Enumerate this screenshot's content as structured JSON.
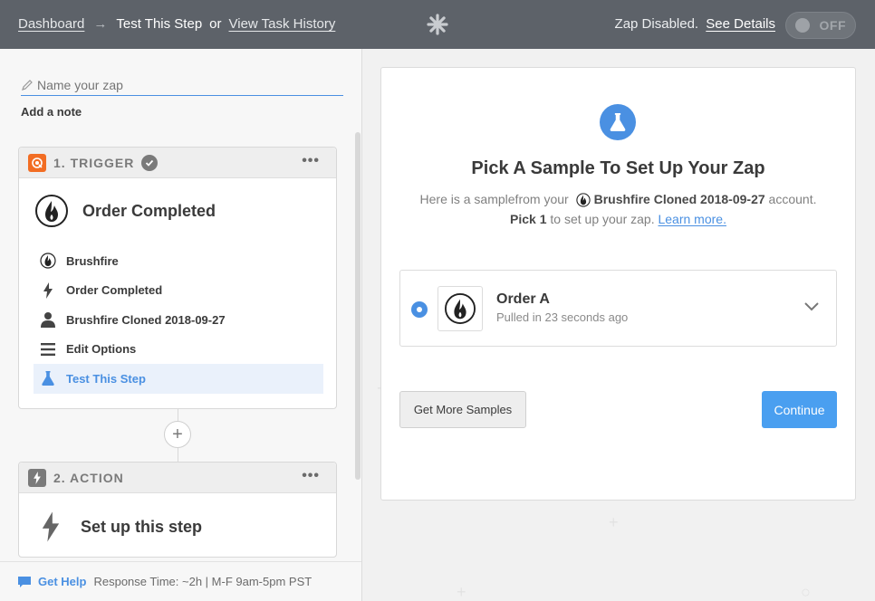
{
  "header": {
    "breadcrumb": {
      "dashboard": "Dashboard",
      "arrow": "→",
      "current": "Test This Step",
      "or": "or",
      "history": "View Task History"
    },
    "status_text": "Zap Disabled.",
    "see_details": "See Details",
    "toggle_label": "OFF"
  },
  "sidebar": {
    "zap_name_placeholder": "Name your zap",
    "add_note": "Add a note",
    "trigger": {
      "number_title": "1. TRIGGER",
      "menu": "•••",
      "app_event": "Order Completed",
      "steps": [
        {
          "label": "Brushfire",
          "icon": "brushfire-icon"
        },
        {
          "label": "Order Completed",
          "icon": "bolt-icon"
        },
        {
          "label": "Brushfire Cloned 2018-09-27",
          "icon": "user-icon"
        },
        {
          "label": "Edit Options",
          "icon": "lines-icon"
        },
        {
          "label": "Test This Step",
          "icon": "flask-icon"
        }
      ]
    },
    "add_step": "+",
    "action": {
      "number_title": "2. ACTION",
      "menu": "•••",
      "setup_label": "Set up this step"
    },
    "help": {
      "label": "Get Help",
      "response": "Response Time: ~2h | M-F 9am-5pm PST"
    }
  },
  "main": {
    "title": "Pick A Sample To Set Up Your Zap",
    "desc_prefix": "Here is a samplefrom your",
    "account": "Brushfire Cloned 2018-09-27",
    "desc_suffix": "account.",
    "pick_bold": "Pick 1",
    "pick_rest": "to set up your zap.",
    "learn_more": "Learn more.",
    "sample": {
      "name": "Order A",
      "pulled": "Pulled in 23 seconds ago"
    },
    "get_more_samples": "Get More Samples",
    "continue": "Continue"
  },
  "colors": {
    "topbar": "#5d6269",
    "accent": "#4a90e2",
    "trigger_badge": "#f26d23",
    "action_badge": "#7a7a7a"
  }
}
